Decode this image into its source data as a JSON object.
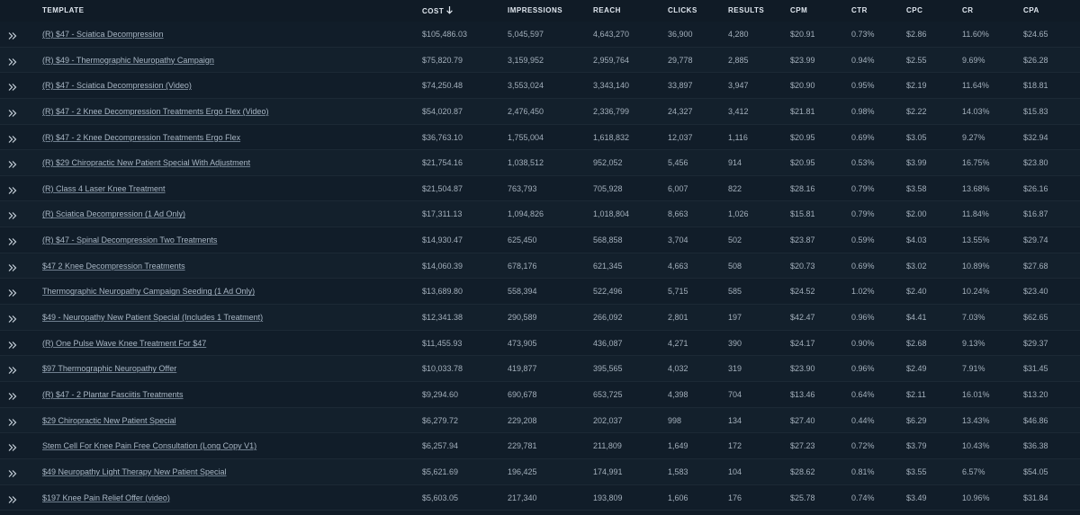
{
  "header": {
    "template": "TEMPLATE",
    "cost": "COST",
    "impressions": "IMPRESSIONS",
    "reach": "REACH",
    "clicks": "CLICKS",
    "results": "RESULTS",
    "cpm": "CPM",
    "ctr": "CTR",
    "cpc": "CPC",
    "cr": "CR",
    "cpa": "CPA",
    "sort_icon": "arrow-down-icon"
  },
  "row_icon": "double-chevron-right-icon",
  "rows": [
    {
      "name": "(R) $47 - Sciatica Decompression",
      "cost": "$105,486.03",
      "impressions": "5,045,597",
      "reach": "4,643,270",
      "clicks": "36,900",
      "results": "4,280",
      "cpm": "$20.91",
      "ctr": "0.73%",
      "cpc": "$2.86",
      "cr": "11.60%",
      "cpa": "$24.65"
    },
    {
      "name": "(R) $49 - Thermographic Neuropathy Campaign",
      "cost": "$75,820.79",
      "impressions": "3,159,952",
      "reach": "2,959,764",
      "clicks": "29,778",
      "results": "2,885",
      "cpm": "$23.99",
      "ctr": "0.94%",
      "cpc": "$2.55",
      "cr": "9.69%",
      "cpa": "$26.28"
    },
    {
      "name": "(R) $47 - Sciatica Decompression (Video)",
      "cost": "$74,250.48",
      "impressions": "3,553,024",
      "reach": "3,343,140",
      "clicks": "33,897",
      "results": "3,947",
      "cpm": "$20.90",
      "ctr": "0.95%",
      "cpc": "$2.19",
      "cr": "11.64%",
      "cpa": "$18.81"
    },
    {
      "name": "(R) $47 - 2 Knee Decompression Treatments Ergo Flex (Video)",
      "cost": "$54,020.87",
      "impressions": "2,476,450",
      "reach": "2,336,799",
      "clicks": "24,327",
      "results": "3,412",
      "cpm": "$21.81",
      "ctr": "0.98%",
      "cpc": "$2.22",
      "cr": "14.03%",
      "cpa": "$15.83"
    },
    {
      "name": "(R) $47 - 2 Knee Decompression Treatments Ergo Flex",
      "cost": "$36,763.10",
      "impressions": "1,755,004",
      "reach": "1,618,832",
      "clicks": "12,037",
      "results": "1,116",
      "cpm": "$20.95",
      "ctr": "0.69%",
      "cpc": "$3.05",
      "cr": "9.27%",
      "cpa": "$32.94"
    },
    {
      "name": "(R) $29 Chiropractic New Patient Special With Adjustment",
      "cost": "$21,754.16",
      "impressions": "1,038,512",
      "reach": "952,052",
      "clicks": "5,456",
      "results": "914",
      "cpm": "$20.95",
      "ctr": "0.53%",
      "cpc": "$3.99",
      "cr": "16.75%",
      "cpa": "$23.80"
    },
    {
      "name": "(R) Class 4 Laser Knee Treatment",
      "cost": "$21,504.87",
      "impressions": "763,793",
      "reach": "705,928",
      "clicks": "6,007",
      "results": "822",
      "cpm": "$28.16",
      "ctr": "0.79%",
      "cpc": "$3.58",
      "cr": "13.68%",
      "cpa": "$26.16"
    },
    {
      "name": "(R) Sciatica Decompression (1 Ad Only)",
      "cost": "$17,311.13",
      "impressions": "1,094,826",
      "reach": "1,018,804",
      "clicks": "8,663",
      "results": "1,026",
      "cpm": "$15.81",
      "ctr": "0.79%",
      "cpc": "$2.00",
      "cr": "11.84%",
      "cpa": "$16.87"
    },
    {
      "name": "(R) $47 - Spinal Decompression Two Treatments",
      "cost": "$14,930.47",
      "impressions": "625,450",
      "reach": "568,858",
      "clicks": "3,704",
      "results": "502",
      "cpm": "$23.87",
      "ctr": "0.59%",
      "cpc": "$4.03",
      "cr": "13.55%",
      "cpa": "$29.74"
    },
    {
      "name": "$47 2 Knee Decompression Treatments",
      "cost": "$14,060.39",
      "impressions": "678,176",
      "reach": "621,345",
      "clicks": "4,663",
      "results": "508",
      "cpm": "$20.73",
      "ctr": "0.69%",
      "cpc": "$3.02",
      "cr": "10.89%",
      "cpa": "$27.68"
    },
    {
      "name": "Thermographic Neuropathy Campaign Seeding (1 Ad Only)",
      "cost": "$13,689.80",
      "impressions": "558,394",
      "reach": "522,496",
      "clicks": "5,715",
      "results": "585",
      "cpm": "$24.52",
      "ctr": "1.02%",
      "cpc": "$2.40",
      "cr": "10.24%",
      "cpa": "$23.40"
    },
    {
      "name": "$49 - Neuropathy New Patient Special (Includes 1 Treatment)",
      "cost": "$12,341.38",
      "impressions": "290,589",
      "reach": "266,092",
      "clicks": "2,801",
      "results": "197",
      "cpm": "$42.47",
      "ctr": "0.96%",
      "cpc": "$4.41",
      "cr": "7.03%",
      "cpa": "$62.65"
    },
    {
      "name": "(R) One Pulse Wave Knee Treatment For $47",
      "cost": "$11,455.93",
      "impressions": "473,905",
      "reach": "436,087",
      "clicks": "4,271",
      "results": "390",
      "cpm": "$24.17",
      "ctr": "0.90%",
      "cpc": "$2.68",
      "cr": "9.13%",
      "cpa": "$29.37"
    },
    {
      "name": "$97 Thermographic Neuropathy Offer",
      "cost": "$10,033.78",
      "impressions": "419,877",
      "reach": "395,565",
      "clicks": "4,032",
      "results": "319",
      "cpm": "$23.90",
      "ctr": "0.96%",
      "cpc": "$2.49",
      "cr": "7.91%",
      "cpa": "$31.45"
    },
    {
      "name": "(R) $47 - 2 Plantar Fasciitis Treatments",
      "cost": "$9,294.60",
      "impressions": "690,678",
      "reach": "653,725",
      "clicks": "4,398",
      "results": "704",
      "cpm": "$13.46",
      "ctr": "0.64%",
      "cpc": "$2.11",
      "cr": "16.01%",
      "cpa": "$13.20"
    },
    {
      "name": "$29 Chiropractic New Patient Special",
      "cost": "$6,279.72",
      "impressions": "229,208",
      "reach": "202,037",
      "clicks": "998",
      "results": "134",
      "cpm": "$27.40",
      "ctr": "0.44%",
      "cpc": "$6.29",
      "cr": "13.43%",
      "cpa": "$46.86"
    },
    {
      "name": "Stem Cell For Knee Pain Free Consultation (Long Copy V1)",
      "cost": "$6,257.94",
      "impressions": "229,781",
      "reach": "211,809",
      "clicks": "1,649",
      "results": "172",
      "cpm": "$27.23",
      "ctr": "0.72%",
      "cpc": "$3.79",
      "cr": "10.43%",
      "cpa": "$36.38"
    },
    {
      "name": "$49 Neuropathy Light Therapy New Patient Special",
      "cost": "$5,621.69",
      "impressions": "196,425",
      "reach": "174,991",
      "clicks": "1,583",
      "results": "104",
      "cpm": "$28.62",
      "ctr": "0.81%",
      "cpc": "$3.55",
      "cr": "6.57%",
      "cpa": "$54.05"
    },
    {
      "name": "$197 Knee Pain Relief Offer (video)",
      "cost": "$5,603.05",
      "impressions": "217,340",
      "reach": "193,809",
      "clicks": "1,606",
      "results": "176",
      "cpm": "$25.78",
      "ctr": "0.74%",
      "cpc": "$3.49",
      "cr": "10.96%",
      "cpa": "$31.84"
    }
  ]
}
